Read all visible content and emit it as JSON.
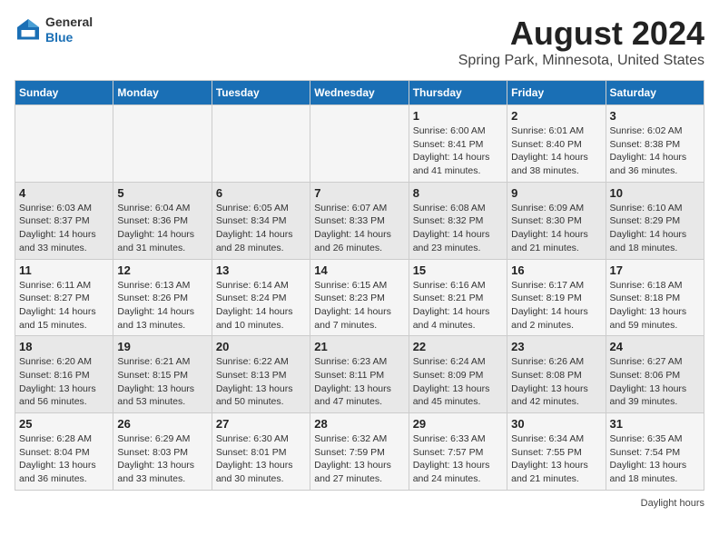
{
  "logo": {
    "line1": "General",
    "line2": "Blue"
  },
  "title": "August 2024",
  "subtitle": "Spring Park, Minnesota, United States",
  "days_of_week": [
    "Sunday",
    "Monday",
    "Tuesday",
    "Wednesday",
    "Thursday",
    "Friday",
    "Saturday"
  ],
  "footer": {
    "daylight_label": "Daylight hours"
  },
  "weeks": [
    [
      {
        "day": "",
        "info": ""
      },
      {
        "day": "",
        "info": ""
      },
      {
        "day": "",
        "info": ""
      },
      {
        "day": "",
        "info": ""
      },
      {
        "day": "1",
        "info": "Sunrise: 6:00 AM\nSunset: 8:41 PM\nDaylight: 14 hours\nand 41 minutes."
      },
      {
        "day": "2",
        "info": "Sunrise: 6:01 AM\nSunset: 8:40 PM\nDaylight: 14 hours\nand 38 minutes."
      },
      {
        "day": "3",
        "info": "Sunrise: 6:02 AM\nSunset: 8:38 PM\nDaylight: 14 hours\nand 36 minutes."
      }
    ],
    [
      {
        "day": "4",
        "info": "Sunrise: 6:03 AM\nSunset: 8:37 PM\nDaylight: 14 hours\nand 33 minutes."
      },
      {
        "day": "5",
        "info": "Sunrise: 6:04 AM\nSunset: 8:36 PM\nDaylight: 14 hours\nand 31 minutes."
      },
      {
        "day": "6",
        "info": "Sunrise: 6:05 AM\nSunset: 8:34 PM\nDaylight: 14 hours\nand 28 minutes."
      },
      {
        "day": "7",
        "info": "Sunrise: 6:07 AM\nSunset: 8:33 PM\nDaylight: 14 hours\nand 26 minutes."
      },
      {
        "day": "8",
        "info": "Sunrise: 6:08 AM\nSunset: 8:32 PM\nDaylight: 14 hours\nand 23 minutes."
      },
      {
        "day": "9",
        "info": "Sunrise: 6:09 AM\nSunset: 8:30 PM\nDaylight: 14 hours\nand 21 minutes."
      },
      {
        "day": "10",
        "info": "Sunrise: 6:10 AM\nSunset: 8:29 PM\nDaylight: 14 hours\nand 18 minutes."
      }
    ],
    [
      {
        "day": "11",
        "info": "Sunrise: 6:11 AM\nSunset: 8:27 PM\nDaylight: 14 hours\nand 15 minutes."
      },
      {
        "day": "12",
        "info": "Sunrise: 6:13 AM\nSunset: 8:26 PM\nDaylight: 14 hours\nand 13 minutes."
      },
      {
        "day": "13",
        "info": "Sunrise: 6:14 AM\nSunset: 8:24 PM\nDaylight: 14 hours\nand 10 minutes."
      },
      {
        "day": "14",
        "info": "Sunrise: 6:15 AM\nSunset: 8:23 PM\nDaylight: 14 hours\nand 7 minutes."
      },
      {
        "day": "15",
        "info": "Sunrise: 6:16 AM\nSunset: 8:21 PM\nDaylight: 14 hours\nand 4 minutes."
      },
      {
        "day": "16",
        "info": "Sunrise: 6:17 AM\nSunset: 8:19 PM\nDaylight: 14 hours\nand 2 minutes."
      },
      {
        "day": "17",
        "info": "Sunrise: 6:18 AM\nSunset: 8:18 PM\nDaylight: 13 hours\nand 59 minutes."
      }
    ],
    [
      {
        "day": "18",
        "info": "Sunrise: 6:20 AM\nSunset: 8:16 PM\nDaylight: 13 hours\nand 56 minutes."
      },
      {
        "day": "19",
        "info": "Sunrise: 6:21 AM\nSunset: 8:15 PM\nDaylight: 13 hours\nand 53 minutes."
      },
      {
        "day": "20",
        "info": "Sunrise: 6:22 AM\nSunset: 8:13 PM\nDaylight: 13 hours\nand 50 minutes."
      },
      {
        "day": "21",
        "info": "Sunrise: 6:23 AM\nSunset: 8:11 PM\nDaylight: 13 hours\nand 47 minutes."
      },
      {
        "day": "22",
        "info": "Sunrise: 6:24 AM\nSunset: 8:09 PM\nDaylight: 13 hours\nand 45 minutes."
      },
      {
        "day": "23",
        "info": "Sunrise: 6:26 AM\nSunset: 8:08 PM\nDaylight: 13 hours\nand 42 minutes."
      },
      {
        "day": "24",
        "info": "Sunrise: 6:27 AM\nSunset: 8:06 PM\nDaylight: 13 hours\nand 39 minutes."
      }
    ],
    [
      {
        "day": "25",
        "info": "Sunrise: 6:28 AM\nSunset: 8:04 PM\nDaylight: 13 hours\nand 36 minutes."
      },
      {
        "day": "26",
        "info": "Sunrise: 6:29 AM\nSunset: 8:03 PM\nDaylight: 13 hours\nand 33 minutes."
      },
      {
        "day": "27",
        "info": "Sunrise: 6:30 AM\nSunset: 8:01 PM\nDaylight: 13 hours\nand 30 minutes."
      },
      {
        "day": "28",
        "info": "Sunrise: 6:32 AM\nSunset: 7:59 PM\nDaylight: 13 hours\nand 27 minutes."
      },
      {
        "day": "29",
        "info": "Sunrise: 6:33 AM\nSunset: 7:57 PM\nDaylight: 13 hours\nand 24 minutes."
      },
      {
        "day": "30",
        "info": "Sunrise: 6:34 AM\nSunset: 7:55 PM\nDaylight: 13 hours\nand 21 minutes."
      },
      {
        "day": "31",
        "info": "Sunrise: 6:35 AM\nSunset: 7:54 PM\nDaylight: 13 hours\nand 18 minutes."
      }
    ]
  ]
}
